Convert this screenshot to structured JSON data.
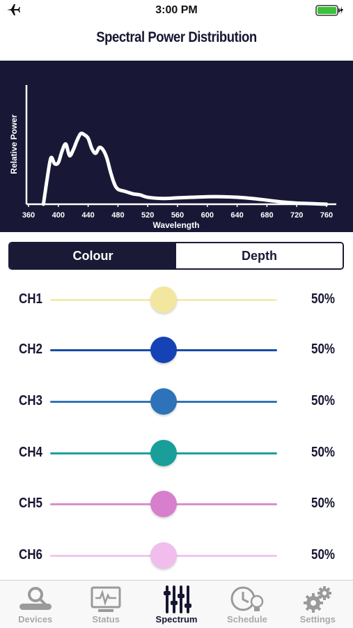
{
  "status_bar": {
    "time": "3:00 PM"
  },
  "nav": {
    "title": "Spectral Power Distribution"
  },
  "chart_data": {
    "type": "line",
    "xlabel": "Wavelength",
    "ylabel": "Relative Power",
    "x_ticks": [
      "360",
      "400",
      "440",
      "480",
      "520",
      "560",
      "600",
      "640",
      "680",
      "720",
      "760"
    ],
    "xlim": [
      360,
      760
    ],
    "ylim": [
      0,
      1
    ],
    "x": [
      380,
      385,
      390,
      395,
      400,
      405,
      410,
      415,
      420,
      425,
      430,
      435,
      440,
      445,
      450,
      455,
      460,
      465,
      470,
      475,
      480,
      490,
      500,
      510,
      520,
      540,
      560,
      580,
      600,
      620,
      640,
      660,
      680,
      700,
      720,
      740,
      760
    ],
    "y": [
      0.0,
      0.22,
      0.4,
      0.35,
      0.36,
      0.46,
      0.52,
      0.42,
      0.47,
      0.55,
      0.61,
      0.6,
      0.57,
      0.48,
      0.44,
      0.49,
      0.47,
      0.4,
      0.28,
      0.18,
      0.13,
      0.11,
      0.09,
      0.08,
      0.06,
      0.05,
      0.055,
      0.06,
      0.065,
      0.065,
      0.06,
      0.05,
      0.035,
      0.02,
      0.01,
      0.005,
      0.0
    ]
  },
  "segments": {
    "colour": "Colour",
    "depth": "Depth",
    "active": "colour"
  },
  "channels": [
    {
      "label": "CH1",
      "value_text": "50%",
      "level": 0.5,
      "color": "#f3e7a0",
      "track": "#f6eab0"
    },
    {
      "label": "CH2",
      "value_text": "50%",
      "level": 0.5,
      "color": "#1543b5",
      "track": "#1a4aa6"
    },
    {
      "label": "CH3",
      "value_text": "50%",
      "level": 0.5,
      "color": "#2e73b9",
      "track": "#3274b5"
    },
    {
      "label": "CH4",
      "value_text": "50%",
      "level": 0.5,
      "color": "#199e9a",
      "track": "#1ba19e"
    },
    {
      "label": "CH5",
      "value_text": "50%",
      "level": 0.5,
      "color": "#d77fcd",
      "track": "#d88fd0"
    },
    {
      "label": "CH6",
      "value_text": "50%",
      "level": 0.5,
      "color": "#f0bdec",
      "track": "#f1c6ee"
    }
  ],
  "tabs": [
    {
      "label": "Devices",
      "icon": "devices-icon",
      "active": false
    },
    {
      "label": "Status",
      "icon": "status-monitor-icon",
      "active": false
    },
    {
      "label": "Spectrum",
      "icon": "spectrum-sliders-icon",
      "active": true
    },
    {
      "label": "Schedule",
      "icon": "schedule-clock-icon",
      "active": false
    },
    {
      "label": "Settings",
      "icon": "settings-gear-icon",
      "active": false
    }
  ]
}
